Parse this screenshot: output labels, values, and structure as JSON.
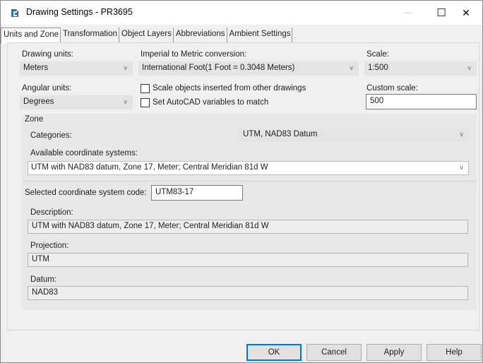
{
  "window": {
    "title": "Drawing Settings - PR3695",
    "icon": "civil3d-app-icon",
    "controls": {
      "minimize": "—",
      "maximize": "☐",
      "close": "✕"
    }
  },
  "tabs": [
    {
      "label": "Units and Zone",
      "active": true
    },
    {
      "label": "Transformation",
      "active": false
    },
    {
      "label": "Object Layers",
      "active": false
    },
    {
      "label": "Abbreviations",
      "active": false
    },
    {
      "label": "Ambient Settings",
      "active": false
    }
  ],
  "units": {
    "drawing_units_label": "Drawing units:",
    "drawing_units_value": "Meters",
    "imperial_label": "Imperial to Metric conversion:",
    "imperial_value": "International Foot(1 Foot = 0.3048 Meters)",
    "scale_label": "Scale:",
    "scale_value": "1:500",
    "angular_label": "Angular units:",
    "angular_value": "Degrees",
    "scale_objects_label": "Scale objects inserted from other drawings",
    "scale_objects_checked": false,
    "set_autocad_label": "Set AutoCAD variables to match",
    "set_autocad_checked": false,
    "custom_scale_label": "Custom scale:",
    "custom_scale_value": "500"
  },
  "zone": {
    "group_label": "Zone",
    "categories_label": "Categories:",
    "categories_value": "UTM, NAD83 Datum",
    "available_label": "Available coordinate systems:",
    "available_value": "UTM with NAD83 datum, Zone 17, Meter; Central Meridian 81d W",
    "selected_code_label": "Selected coordinate system code:",
    "selected_code_value": "UTM83-17",
    "description_label": "Description:",
    "description_value": "UTM with NAD83 datum, Zone 17, Meter; Central Meridian 81d W",
    "projection_label": "Projection:",
    "projection_value": "UTM",
    "datum_label": "Datum:",
    "datum_value": "NAD83"
  },
  "buttons": {
    "ok": "OK",
    "cancel": "Cancel",
    "apply": "Apply",
    "help": "Help"
  },
  "colors": {
    "accent": "#0078d7",
    "icon_blue": "#2a6fb8",
    "icon_orange": "#e89b2c"
  }
}
